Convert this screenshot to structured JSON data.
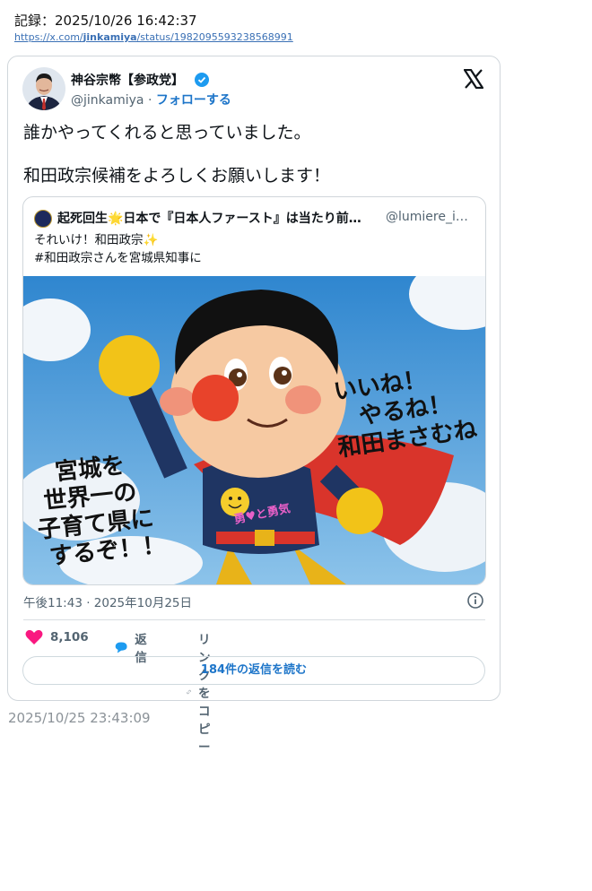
{
  "record": {
    "label": "記録：2025/10/26 16:42:37",
    "link_pre": "https://x.com/",
    "link_user": "jinkamiya",
    "link_post": "/status/1982095593238568991"
  },
  "tweet": {
    "author_name": "神谷宗幣【参政党】",
    "handle": "@jinkamiya",
    "separator": "·",
    "follow_label": "フォローする",
    "text_line1": "誰かやってくれると思っていました。",
    "text_line2": "和田政宗候補をよろしくお願いします！",
    "quote": {
      "author_name": "起死回生🌟日本で『日本人ファースト』は当たり前…",
      "handle": "@lumiere_i…",
      "text_line1": "それいけ！和田政宗✨",
      "text_line2": "#和田政宗さんを宮城県知事に",
      "image": {
        "left_text": [
          "宮城を",
          "世界一の",
          "子育て県に",
          "するぞ！！"
        ],
        "right_text": [
          "いいね！",
          "やるね！",
          "和田まさむね"
        ],
        "chest_text": "勇♥と勇気"
      }
    },
    "time": "午後11:43 · 2025年10月25日",
    "likes": "8,106",
    "reply_label": "返信",
    "copy_link_label": "リンクをコピー",
    "read_replies_label": "184件の返信を読む"
  },
  "footer_timestamp": "2025/10/25 23:43:09",
  "colors": {
    "accent": "#1d9bf0",
    "like": "#f91880",
    "link": "#1d75c9"
  }
}
